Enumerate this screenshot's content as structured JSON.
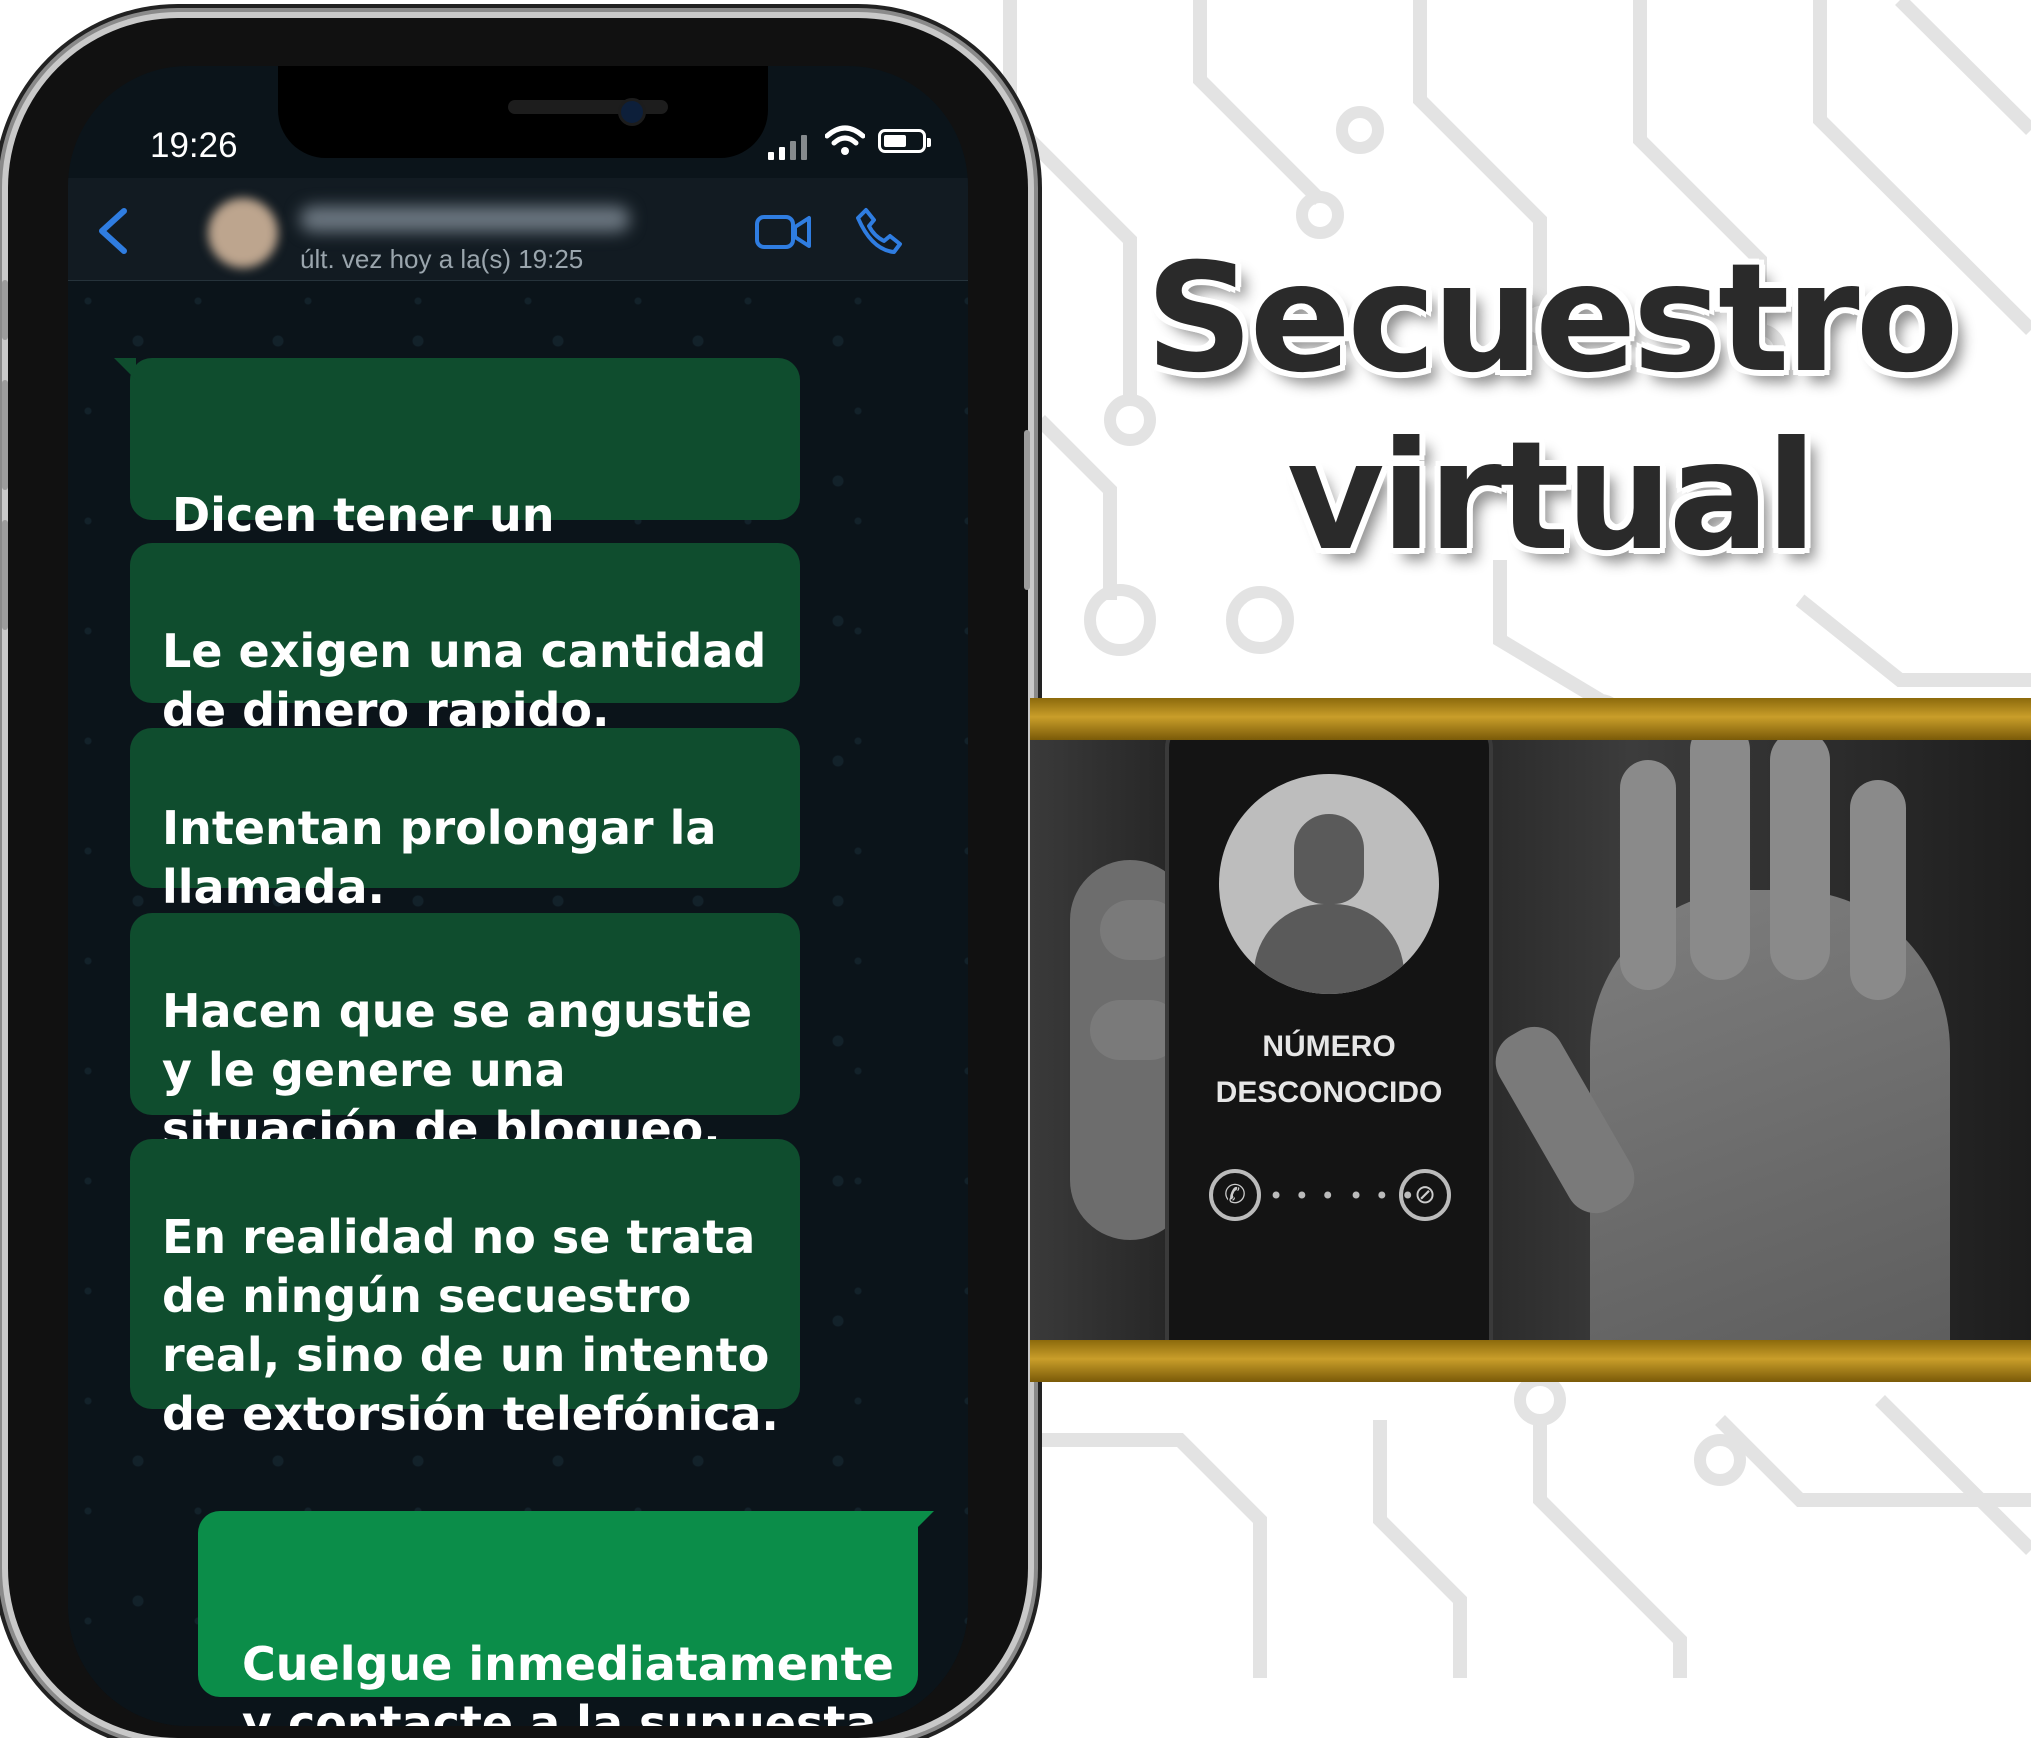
{
  "phone": {
    "status_time": "19:26",
    "header": {
      "last_seen": "últ. vez hoy a la(s) 19:25"
    },
    "messages": [
      {
        "text": "Dicen tener un\nfamiliar secuestrado."
      },
      {
        "text": "Le exigen una cantidad\nde dinero rapido."
      },
      {
        "text": "Intentan prolongar la\nllamada."
      },
      {
        "text": "Hacen que se angustie\ny le genere una\nsituación de bloqueo."
      },
      {
        "text": "En realidad no se trata\nde ningún secuestro\nreal, sino de un intento\nde extorsión telefónica."
      },
      {
        "text": "Cuelgue inmediatamente\ny contacte a la supuesta\nvictima."
      }
    ]
  },
  "title": {
    "line1": "Secuestro",
    "line2": "virtual"
  },
  "photo": {
    "caller_line1": "NÚMERO",
    "caller_line2": "DESCONOCIDO"
  },
  "colors": {
    "incoming_bubble": "#0f4d2e",
    "outgoing_bubble": "#0b8d49",
    "gold_band": "#c99e2a",
    "title_text": "#2a2a2a",
    "ios_blue": "#2f7de1"
  }
}
